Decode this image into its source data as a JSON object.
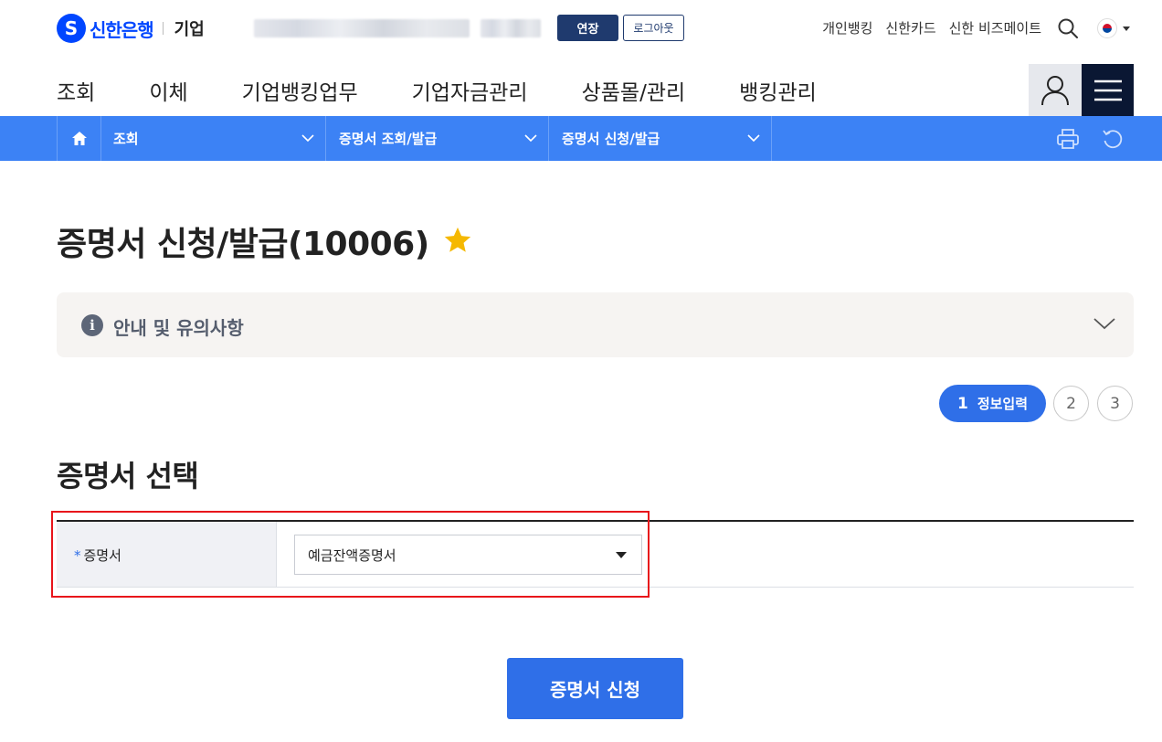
{
  "header": {
    "brand": "신한은행",
    "sub_brand": "기업",
    "extend_label": "연장",
    "logout_label": "로그아웃",
    "links": [
      "개인뱅킹",
      "신한카드",
      "신한 비즈메이트"
    ],
    "icons": {
      "search": "search-icon",
      "language": "korea-flag-icon"
    }
  },
  "nav": {
    "items": [
      "조회",
      "이체",
      "기업뱅킹업무",
      "기업자금관리",
      "상품몰/관리",
      "뱅킹관리"
    ],
    "icons": {
      "user": "user-icon",
      "menu": "hamburger-menu-icon"
    }
  },
  "breadcrumb": {
    "items": [
      "조회",
      "증명서 조회/발급",
      "증명서 신청/발급"
    ],
    "icons": {
      "home": "home-icon",
      "print": "printer-icon",
      "refresh": "refresh-icon"
    }
  },
  "page": {
    "title": "증명서 신청/발급(10006)",
    "notice": "안내 및 유의사항",
    "steps": [
      {
        "num": "1",
        "label": "정보입력",
        "active": true
      },
      {
        "num": "2",
        "label": "",
        "active": false
      },
      {
        "num": "3",
        "label": "",
        "active": false
      }
    ],
    "section_title": "증명서 선택",
    "form": {
      "required_mark": "*",
      "label": "증명서",
      "selected": "예금잔액증명서"
    },
    "submit_label": "증명서 신청"
  },
  "colors": {
    "brand_blue": "#0046ff",
    "breadcrumb_bar": "#3c82f5",
    "primary_button": "#2f6fe8",
    "navy": "#1f3a6e",
    "highlight_red": "#e8141b",
    "star": "#f5b800"
  }
}
